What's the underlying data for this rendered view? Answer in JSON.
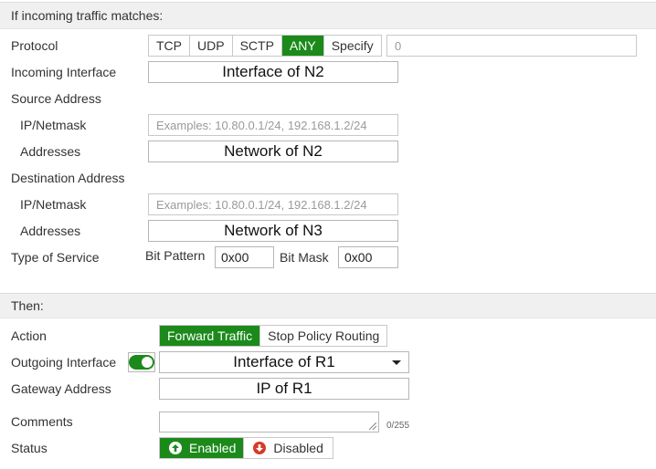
{
  "match_section": {
    "title": "If incoming traffic matches:"
  },
  "protocol": {
    "label": "Protocol",
    "options": [
      "TCP",
      "UDP",
      "SCTP",
      "ANY",
      "Specify"
    ],
    "selected": "ANY",
    "specify_value": "0"
  },
  "incoming_interface": {
    "label": "Incoming Interface",
    "value": "Interface of N2"
  },
  "source_address": {
    "label": "Source Address",
    "ip_label": "IP/Netmask",
    "ip_placeholder": "Examples: 10.80.0.1/24, 192.168.1.2/24",
    "addresses_label": "Addresses",
    "addresses_value": "Network of N2"
  },
  "destination_address": {
    "label": "Destination Address",
    "ip_label": "IP/Netmask",
    "ip_placeholder": "Examples: 10.80.0.1/24, 192.168.1.2/24",
    "addresses_label": "Addresses",
    "addresses_value": "Network of N3"
  },
  "type_of_service": {
    "label": "Type of Service",
    "bit_pattern_label": "Bit Pattern",
    "bit_pattern_value": "0x00",
    "bit_mask_label": "Bit Mask",
    "bit_mask_value": "0x00"
  },
  "then_section": {
    "title": "Then:"
  },
  "action": {
    "label": "Action",
    "options": [
      "Forward Traffic",
      "Stop Policy Routing"
    ],
    "selected": "Forward Traffic"
  },
  "outgoing_interface": {
    "label": "Outgoing Interface",
    "value": "Interface of R1",
    "toggle_on": true
  },
  "gateway_address": {
    "label": "Gateway Address",
    "value": "IP of R1"
  },
  "comments": {
    "label": "Comments",
    "value": "",
    "counter": "0/255"
  },
  "status": {
    "label": "Status",
    "enabled_label": "Enabled",
    "disabled_label": "Disabled",
    "selected": "Enabled"
  },
  "colors": {
    "accent_green": "#1b8a1b",
    "disabled_red": "#d43b2a"
  }
}
